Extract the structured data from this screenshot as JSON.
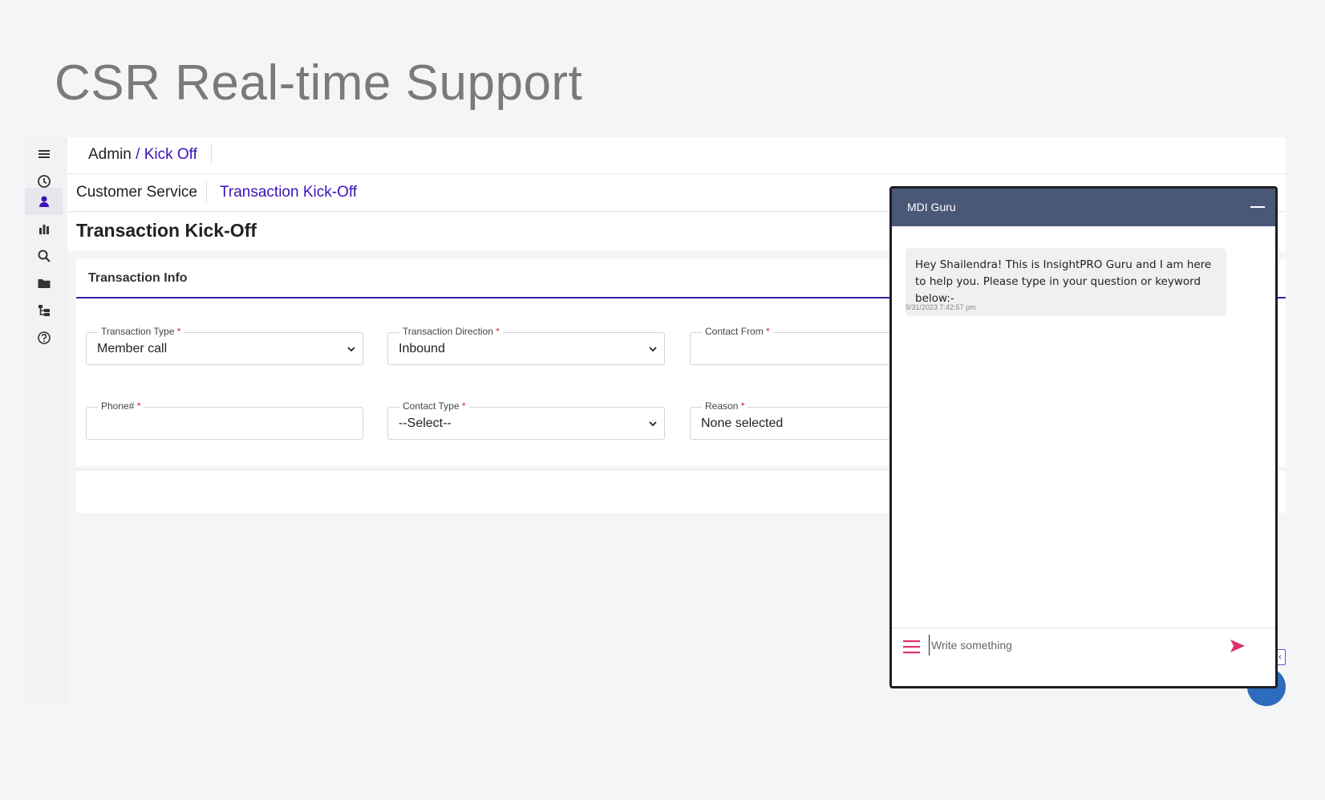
{
  "slide": {
    "title": "CSR Real-time Support"
  },
  "sidebar": {
    "icons": [
      {
        "name": "menu-icon"
      },
      {
        "name": "clock-icon"
      },
      {
        "name": "user-icon",
        "active": true
      },
      {
        "name": "bar-chart-icon"
      },
      {
        "name": "search-icon"
      },
      {
        "name": "folder-icon"
      },
      {
        "name": "hierarchy-icon"
      },
      {
        "name": "help-icon"
      }
    ]
  },
  "breadcrumb": {
    "root": "Admin",
    "separator": " / ",
    "current": "Kick Off"
  },
  "subnav": {
    "tab1": "Customer Service",
    "tab2": "Transaction Kick-Off"
  },
  "page": {
    "title": "Transaction Kick-Off"
  },
  "form": {
    "section_title": "Transaction Info",
    "required_mark": "*",
    "fields": {
      "transaction_type": {
        "label": "Transaction Type",
        "value": "Member call"
      },
      "transaction_direction": {
        "label": "Transaction Direction",
        "value": "Inbound"
      },
      "contact_from": {
        "label": "Contact From",
        "value": ""
      },
      "phone": {
        "label": "Phone#",
        "value": ""
      },
      "contact_type": {
        "label": "Contact Type",
        "value": "--Select--"
      },
      "reason": {
        "label": "Reason",
        "value": "None selected"
      }
    }
  },
  "chat": {
    "title": "MDI Guru",
    "message": "Hey Shailendra! This is InsightPRO Guru and I am here to help you. Please type in your question or keyword below:-",
    "timestamp": "9/31/2023 7:42:57 pm",
    "input_placeholder": "Write something"
  },
  "colors": {
    "accent": "#3a12b8",
    "chat_header": "#4a5878",
    "send": "#e0316b",
    "required": "#e02020"
  }
}
